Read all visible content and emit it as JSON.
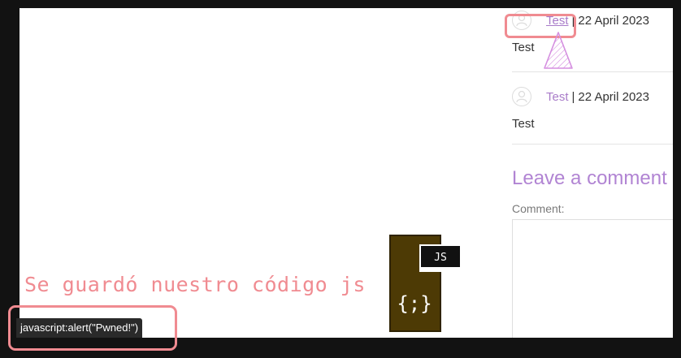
{
  "comments": [
    {
      "author": "Test",
      "separator": "|",
      "date": "22 April 2023",
      "text": "Test"
    },
    {
      "author": "Test",
      "separator": "|",
      "date": "22 April 2023",
      "text": "Test"
    }
  ],
  "form": {
    "heading": "Leave a comment",
    "comment_label": "Comment:"
  },
  "annotation": {
    "caption": "Se guardó nuestro código js",
    "status_url": "javascript:alert(\"Pwned!\")",
    "js_badge": "JS",
    "js_braces": "{;}"
  },
  "colors": {
    "link": "#a97cc9",
    "heading": "#b184d3",
    "highlight": "#f08b91",
    "js_file": "#4d3a05"
  },
  "icons": {
    "avatar": "user-avatar-icon",
    "cursor": "cursor-pointer-icon",
    "js_file": "js-file-icon"
  }
}
